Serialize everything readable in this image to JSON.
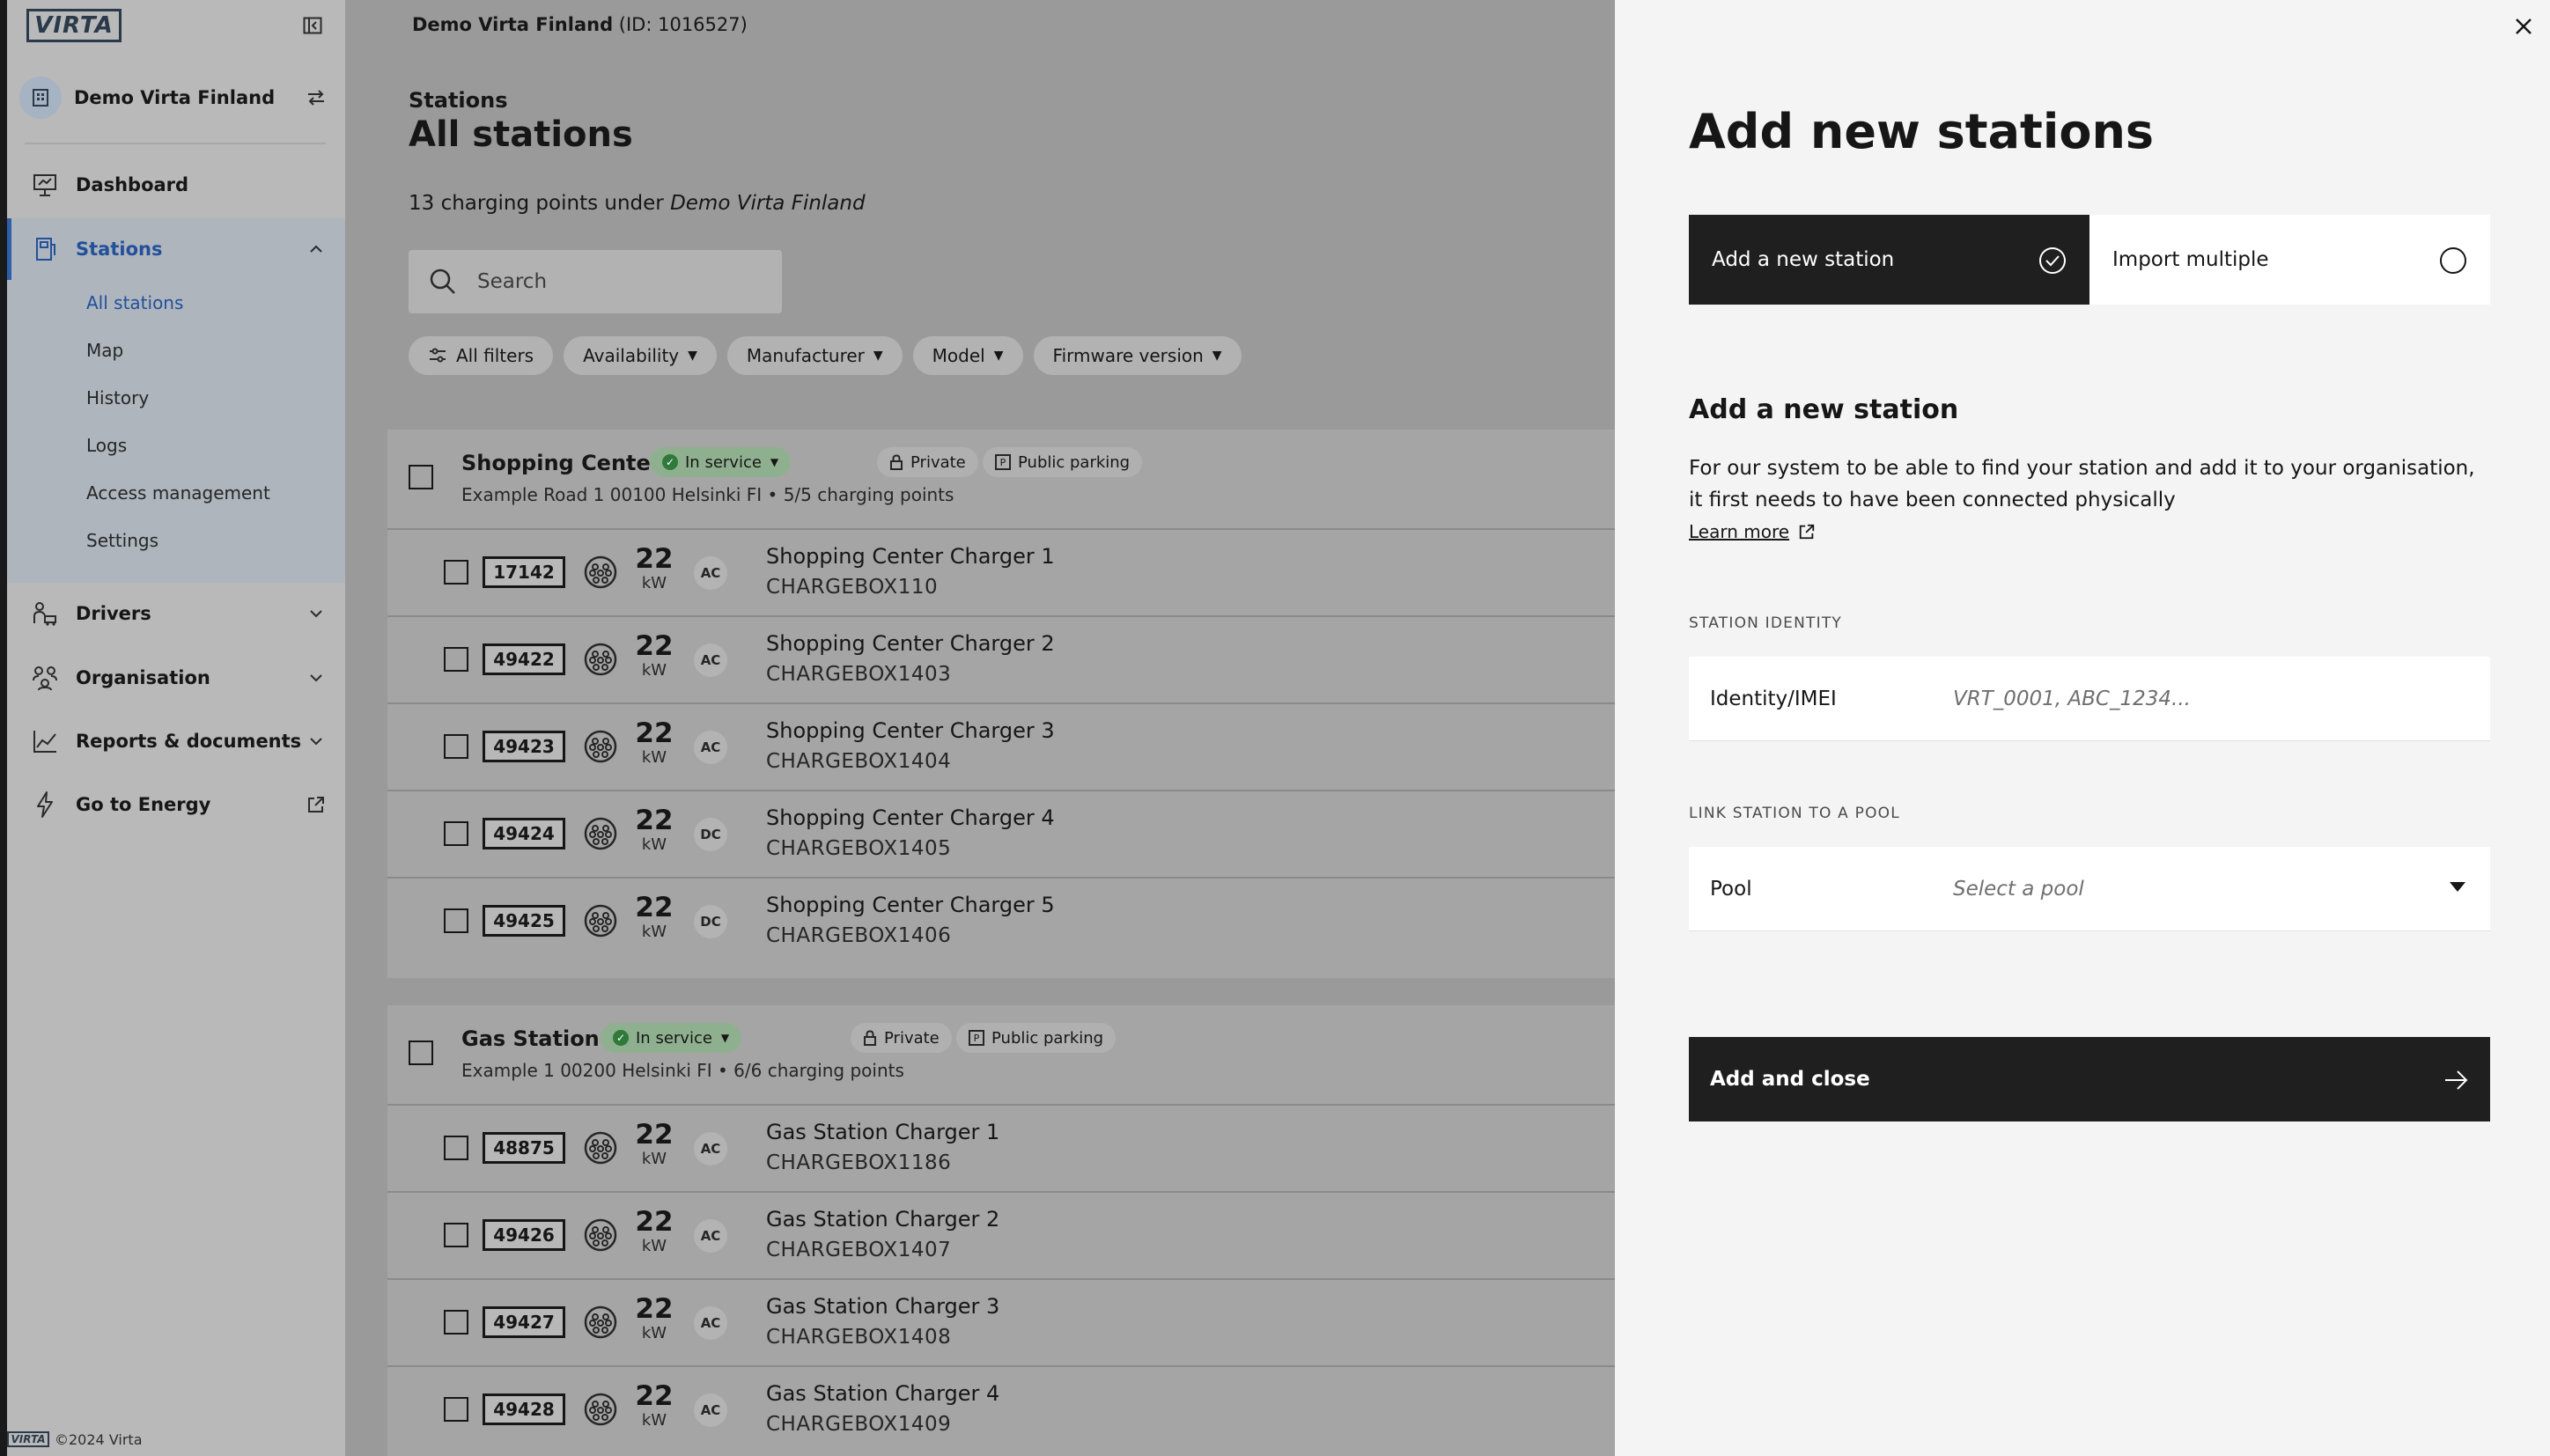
{
  "sidebar": {
    "logo_text": "VIRTA",
    "org_name": "Demo Virta Finland",
    "nav": [
      {
        "label": "Dashboard",
        "icon": "dashboard-icon"
      },
      {
        "label": "Stations",
        "icon": "station-icon",
        "active": true
      },
      {
        "label": "Drivers",
        "icon": "drivers-icon"
      },
      {
        "label": "Organisation",
        "icon": "organisation-icon"
      },
      {
        "label": "Reports & documents",
        "icon": "reports-icon"
      },
      {
        "label": "Go to Energy",
        "icon": "energy-icon"
      }
    ],
    "station_subnav": [
      "All stations",
      "Map",
      "History",
      "Logs",
      "Access management",
      "Settings"
    ],
    "footer": {
      "logo_text": "VIRTA",
      "copyright": "©2024 Virta"
    }
  },
  "main": {
    "org_header_name": "Demo Virta Finland",
    "org_header_id": "(ID: 1016527)",
    "breadcrumb": "Stations",
    "title": "All stations",
    "count_prefix": "13 charging points under",
    "count_org": "Demo Virta Finland",
    "search_placeholder": "Search",
    "filters": [
      "All filters",
      "Availability",
      "Manufacturer",
      "Model",
      "Firmware version"
    ],
    "groups": [
      {
        "name": "Shopping Center Helsinki",
        "status": "In service",
        "access": "Private",
        "parking": "Public parking",
        "address": "Example Road 1 00100 Helsinki FI • 5/5 charging points",
        "chargers": [
          {
            "id": "17142",
            "kw": "22",
            "unit": "kW",
            "type": "AC",
            "name": "Shopping Center Charger 1",
            "box": "CHARGEBOX110"
          },
          {
            "id": "49422",
            "kw": "22",
            "unit": "kW",
            "type": "AC",
            "name": "Shopping Center Charger 2",
            "box": "CHARGEBOX1403"
          },
          {
            "id": "49423",
            "kw": "22",
            "unit": "kW",
            "type": "AC",
            "name": "Shopping Center Charger 3",
            "box": "CHARGEBOX1404"
          },
          {
            "id": "49424",
            "kw": "22",
            "unit": "kW",
            "type": "DC",
            "name": "Shopping Center Charger 4",
            "box": "CHARGEBOX1405"
          },
          {
            "id": "49425",
            "kw": "22",
            "unit": "kW",
            "type": "DC",
            "name": "Shopping Center Charger 5",
            "box": "CHARGEBOX1406"
          }
        ]
      },
      {
        "name": "Gas Station Helsinki",
        "status": "In service",
        "access": "Private",
        "parking": "Public parking",
        "address": "Example 1 00200 Helsinki FI • 6/6 charging points",
        "chargers": [
          {
            "id": "48875",
            "kw": "22",
            "unit": "kW",
            "type": "AC",
            "name": "Gas Station Charger 1",
            "box": "CHARGEBOX1186"
          },
          {
            "id": "49426",
            "kw": "22",
            "unit": "kW",
            "type": "AC",
            "name": "Gas Station Charger 2",
            "box": "CHARGEBOX1407"
          },
          {
            "id": "49427",
            "kw": "22",
            "unit": "kW",
            "type": "AC",
            "name": "Gas Station Charger 3",
            "box": "CHARGEBOX1408"
          },
          {
            "id": "49428",
            "kw": "22",
            "unit": "kW",
            "type": "AC",
            "name": "Gas Station Charger 4",
            "box": "CHARGEBOX1409"
          }
        ]
      }
    ]
  },
  "drawer": {
    "title": "Add new stations",
    "options": [
      {
        "label": "Add a new station",
        "selected": true
      },
      {
        "label": "Import multiple",
        "selected": false
      }
    ],
    "section_title": "Add a new station",
    "description": "For our system to be able to find your station and add it to your organisation, it first needs to have been connected physically",
    "learn_more": "Learn more",
    "identity_section": "STATION IDENTITY",
    "identity_label": "Identity/IMEI",
    "identity_placeholder": "VRT_0001, ABC_1234...",
    "pool_section": "LINK STATION TO A POOL",
    "pool_label": "Pool",
    "pool_placeholder": "Select a pool",
    "submit_label": "Add and close"
  },
  "colors": {
    "accent": "#23509a",
    "status_green": "#2f7a3a",
    "drawer_bg": "#f4f4f4",
    "primary_button": "#1f1f1f"
  }
}
